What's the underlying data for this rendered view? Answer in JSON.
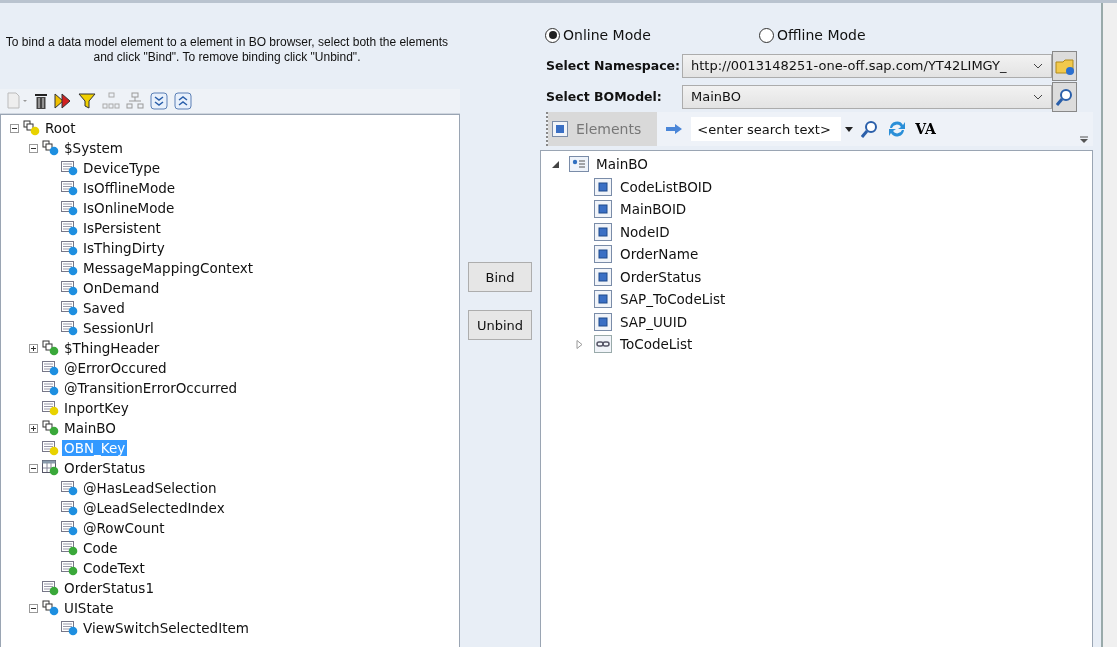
{
  "instructions": "To bind a data model element to a element in BO browser, select both the elements and click \"Bind\". To remove binding click \"Unbind\".",
  "model_tree": [
    {
      "label": "Root",
      "kind": "group",
      "color": "#e8d200",
      "expanded": true,
      "selected": false,
      "children": [
        {
          "label": "$System",
          "kind": "group",
          "color": "#1e8fe0",
          "expanded": true,
          "selected": false,
          "children": [
            {
              "label": "DeviceType",
              "kind": "field",
              "color": "#1e8fe0",
              "selected": false
            },
            {
              "label": "IsOfflineMode",
              "kind": "field",
              "color": "#1e8fe0",
              "selected": false
            },
            {
              "label": "IsOnlineMode",
              "kind": "field",
              "color": "#1e8fe0",
              "selected": false
            },
            {
              "label": "IsPersistent",
              "kind": "field",
              "color": "#1e8fe0",
              "selected": false
            },
            {
              "label": "IsThingDirty",
              "kind": "field",
              "color": "#1e8fe0",
              "selected": false
            },
            {
              "label": "MessageMappingContext",
              "kind": "field",
              "color": "#1e8fe0",
              "selected": false
            },
            {
              "label": "OnDemand",
              "kind": "field",
              "color": "#1e8fe0",
              "selected": false
            },
            {
              "label": "Saved",
              "kind": "field",
              "color": "#1e8fe0",
              "selected": false
            },
            {
              "label": "SessionUrl",
              "kind": "field",
              "color": "#1e8fe0",
              "selected": false
            }
          ]
        },
        {
          "label": "$ThingHeader",
          "kind": "group",
          "color": "#3aa83a",
          "expanded": false,
          "selected": false
        },
        {
          "label": "@ErrorOccured",
          "kind": "field",
          "color": "#1e8fe0",
          "selected": false
        },
        {
          "label": "@TransitionErrorOccurred",
          "kind": "field",
          "color": "#1e8fe0",
          "selected": false
        },
        {
          "label": "InportKey",
          "kind": "field",
          "color": "#e8d200",
          "selected": false
        },
        {
          "label": "MainBO",
          "kind": "group",
          "color": "#3aa83a",
          "expanded": false,
          "selected": false
        },
        {
          "label": "OBN_Key",
          "kind": "field",
          "color": "#e8d200",
          "selected": true
        },
        {
          "label": "OrderStatus",
          "kind": "table",
          "color": "#3aa83a",
          "expanded": true,
          "selected": false,
          "children": [
            {
              "label": "@HasLeadSelection",
              "kind": "field",
              "color": "#1e8fe0",
              "selected": false
            },
            {
              "label": "@LeadSelectedIndex",
              "kind": "field",
              "color": "#1e8fe0",
              "selected": false
            },
            {
              "label": "@RowCount",
              "kind": "field",
              "color": "#1e8fe0",
              "selected": false
            },
            {
              "label": "Code",
              "kind": "field",
              "color": "#3aa83a",
              "selected": false
            },
            {
              "label": "CodeText",
              "kind": "field",
              "color": "#3aa83a",
              "selected": false
            }
          ]
        },
        {
          "label": "OrderStatus1",
          "kind": "field",
          "color": "#3aa83a",
          "selected": false
        },
        {
          "label": "UIState",
          "kind": "group",
          "color": "#1e8fe0",
          "expanded": true,
          "selected": false,
          "children": [
            {
              "label": "ViewSwitchSelectedItem",
              "kind": "field",
              "color": "#1e8fe0",
              "selected": false
            }
          ]
        }
      ]
    }
  ],
  "bind_buttons": [
    "Bind",
    "Unbind"
  ],
  "modes": [
    {
      "label": "Online Mode",
      "selected": true
    },
    {
      "label": "Offline Mode",
      "selected": false
    }
  ],
  "namespace": {
    "label": "Select Namespace:",
    "value": "http://0013148251-one-off.sap.com/YT42LIMGY_"
  },
  "bo_model": {
    "label": "Select BOModel:",
    "value": "MainBO"
  },
  "bo_toolbar": {
    "elements_label": "Elements",
    "search_placeholder": "<enter search text>",
    "va_label": "VA"
  },
  "bo_tree": [
    {
      "label": "MainBO",
      "kind": "node",
      "expanded": true,
      "selected": false,
      "children": [
        {
          "label": "CodeListBOID",
          "kind": "attribute",
          "selected": false
        },
        {
          "label": "MainBOID",
          "kind": "attribute",
          "selected": false
        },
        {
          "label": "NodeID",
          "kind": "attribute",
          "selected": false
        },
        {
          "label": "OrderName",
          "kind": "attribute",
          "selected": false
        },
        {
          "label": "OrderStatus",
          "kind": "attribute",
          "selected": false
        },
        {
          "label": "SAP_ToCodeList",
          "kind": "attribute",
          "selected": false
        },
        {
          "label": "SAP_UUID",
          "kind": "attribute",
          "selected": false
        },
        {
          "label": "ToCodeList",
          "kind": "association",
          "expanded": false,
          "selected": false
        }
      ]
    }
  ]
}
